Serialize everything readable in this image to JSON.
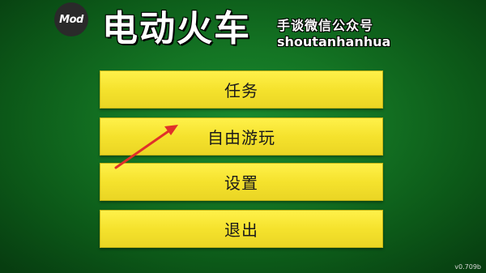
{
  "header": {
    "mod_badge": "Mod",
    "title": "电动火车",
    "watermark_line1": "手谈微信公众号",
    "watermark_line2": "shoutanhanhua"
  },
  "menu": {
    "items": [
      {
        "label": "任务"
      },
      {
        "label": "自由游玩"
      },
      {
        "label": "设置"
      },
      {
        "label": "退出"
      }
    ]
  },
  "annotation": {
    "arrow_color": "#e0302a"
  },
  "footer": {
    "version": "v0.709b"
  },
  "colors": {
    "background": "#147524",
    "button": "#f5e22d",
    "button_text": "#1a1a1a"
  }
}
